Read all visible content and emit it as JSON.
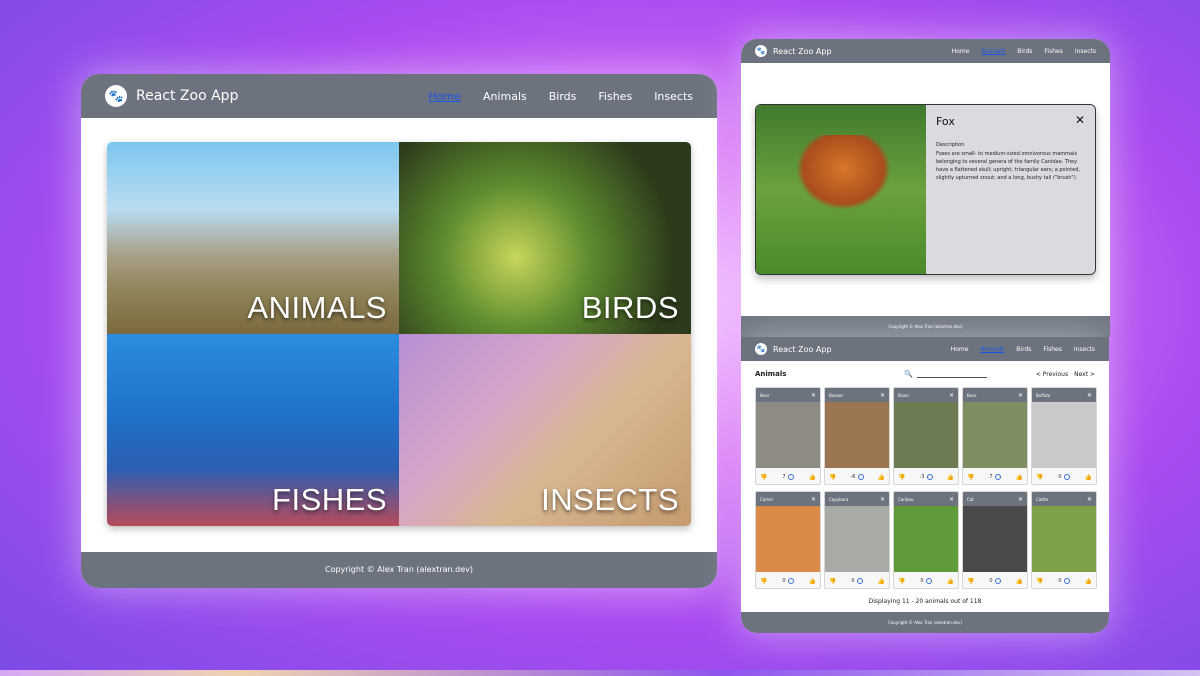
{
  "main": {
    "brand": "React Zoo App",
    "nav": [
      "Home",
      "Animals",
      "Birds",
      "Fishes",
      "Insects"
    ],
    "active_nav": "Home",
    "tiles": [
      {
        "label": "ANIMALS"
      },
      {
        "label": "BIRDS"
      },
      {
        "label": "FISHES"
      },
      {
        "label": "INSECTS"
      }
    ],
    "footer": "Copyright © Alex Tran (alextran.dev)"
  },
  "detail": {
    "brand": "React Zoo App",
    "nav": [
      "Home",
      "Animals",
      "Birds",
      "Fishes",
      "Insects"
    ],
    "active_nav": "Animals",
    "card": {
      "title": "Fox",
      "subtitle": "Description",
      "description": "Foxes are small- to medium-sized omnivorous mammals belonging to several genera of the family Canidae. They have a flattened skull; upright, triangular ears; a pointed, slightly upturned snout; and a long, bushy tail (\"brush\")."
    },
    "footer": "Copyright © Alex Tran (alextran.dev)"
  },
  "list": {
    "brand": "React Zoo App",
    "nav": [
      "Home",
      "Animals",
      "Birds",
      "Fishes",
      "Insects"
    ],
    "active_nav": "Animals",
    "title": "Animals",
    "prev_label": "< Previous",
    "next_label": "Next >",
    "cards": [
      {
        "name": "Bear",
        "down": "",
        "votes": "7",
        "color": "#8e8a84"
      },
      {
        "name": "Beaver",
        "down": "",
        "votes": "-6",
        "color": "#9c7650"
      },
      {
        "name": "Bison",
        "down": "",
        "votes": "-3",
        "color": "#6d7b52"
      },
      {
        "name": "Boar",
        "down": "",
        "votes": "7",
        "color": "#7d8e63"
      },
      {
        "name": "Buffalo",
        "down": "",
        "votes": "0",
        "color": "#c9c9c9"
      },
      {
        "name": "Camel",
        "down": "",
        "votes": "0",
        "color": "#d98a48"
      },
      {
        "name": "Capybara",
        "down": "",
        "votes": "0",
        "color": "#a8aaa6"
      },
      {
        "name": "Caribou",
        "down": "",
        "votes": "0",
        "color": "#5f9a3b"
      },
      {
        "name": "Cat",
        "down": "",
        "votes": "0",
        "color": "#4a4a4a"
      },
      {
        "name": "Cattle",
        "down": "",
        "votes": "0",
        "color": "#7ea048"
      }
    ],
    "status": "Displaying 11 - 20 animals out of 118",
    "footer": "Copyright © Alex Tran (alextran.dev)"
  }
}
